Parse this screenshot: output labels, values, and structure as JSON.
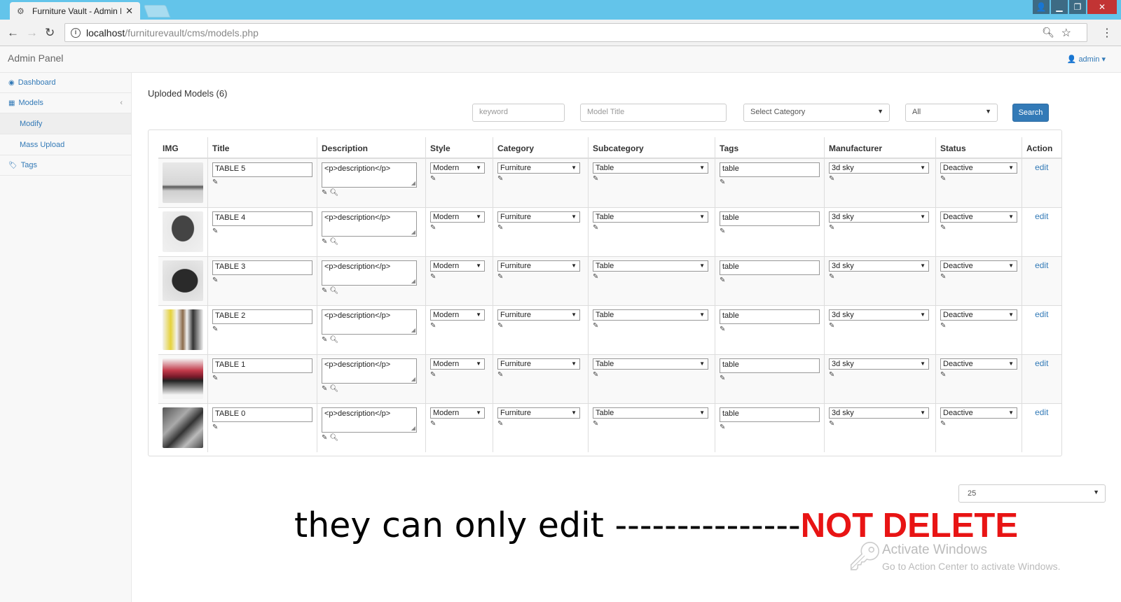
{
  "browser": {
    "tab_title": "Furniture Vault - Admin P",
    "url_host": "localhost",
    "url_path": "/furniturevault/cms/models.php"
  },
  "navbar": {
    "brand": "Admin Panel",
    "user": "admin"
  },
  "sidebar": {
    "items": [
      {
        "label": "Dashboard"
      },
      {
        "label": "Models"
      },
      {
        "label": "Modify"
      },
      {
        "label": "Mass Upload"
      },
      {
        "label": "Tags"
      }
    ]
  },
  "main": {
    "heading": "Uploded Models (6)",
    "filters": {
      "keyword_placeholder": "keyword",
      "title_placeholder": "Model Title",
      "category_selected": "Select Category",
      "status_selected": "All",
      "search_label": "Search"
    },
    "columns": [
      "IMG",
      "Title",
      "Description",
      "Style",
      "Category",
      "Subcategory",
      "Tags",
      "Manufacturer",
      "Status",
      "Action"
    ],
    "rows": [
      {
        "title": "TABLE 5",
        "description": "<p>description</p>",
        "style": "Modern",
        "category": "Furniture",
        "subcategory": "Table",
        "tags": "table",
        "manufacturer": "3d sky",
        "status": "Deactive",
        "action": "edit"
      },
      {
        "title": "TABLE 4",
        "description": "<p>description</p>",
        "style": "Modern",
        "category": "Furniture",
        "subcategory": "Table",
        "tags": "table",
        "manufacturer": "3d sky",
        "status": "Deactive",
        "action": "edit"
      },
      {
        "title": "TABLE 3",
        "description": "<p>description</p>",
        "style": "Modern",
        "category": "Furniture",
        "subcategory": "Table",
        "tags": "table",
        "manufacturer": "3d sky",
        "status": "Deactive",
        "action": "edit"
      },
      {
        "title": "TABLE 2",
        "description": "<p>description</p>",
        "style": "Modern",
        "category": "Furniture",
        "subcategory": "Table",
        "tags": "table",
        "manufacturer": "3d sky",
        "status": "Deactive",
        "action": "edit"
      },
      {
        "title": "TABLE 1",
        "description": "<p>description</p>",
        "style": "Modern",
        "category": "Furniture",
        "subcategory": "Table",
        "tags": "table",
        "manufacturer": "3d sky",
        "status": "Deactive",
        "action": "edit"
      },
      {
        "title": "TABLE 0",
        "description": "<p>description</p>",
        "style": "Modern",
        "category": "Furniture",
        "subcategory": "Table",
        "tags": "table",
        "manufacturer": "3d sky",
        "status": "Deactive",
        "action": "edit"
      }
    ],
    "page_size": "25"
  },
  "annotation": {
    "text": "they can only edit ---------------",
    "emphasis": "NOT DELETE",
    "emphasis_color": "#e81414"
  },
  "watermark": {
    "line1": "Activate Windows",
    "line2": "Go to Action Center to activate Windows."
  },
  "icons": {
    "tab_favicon": "gear-icon",
    "edit": "edit-icon",
    "zoom": "magnifier-icon"
  }
}
